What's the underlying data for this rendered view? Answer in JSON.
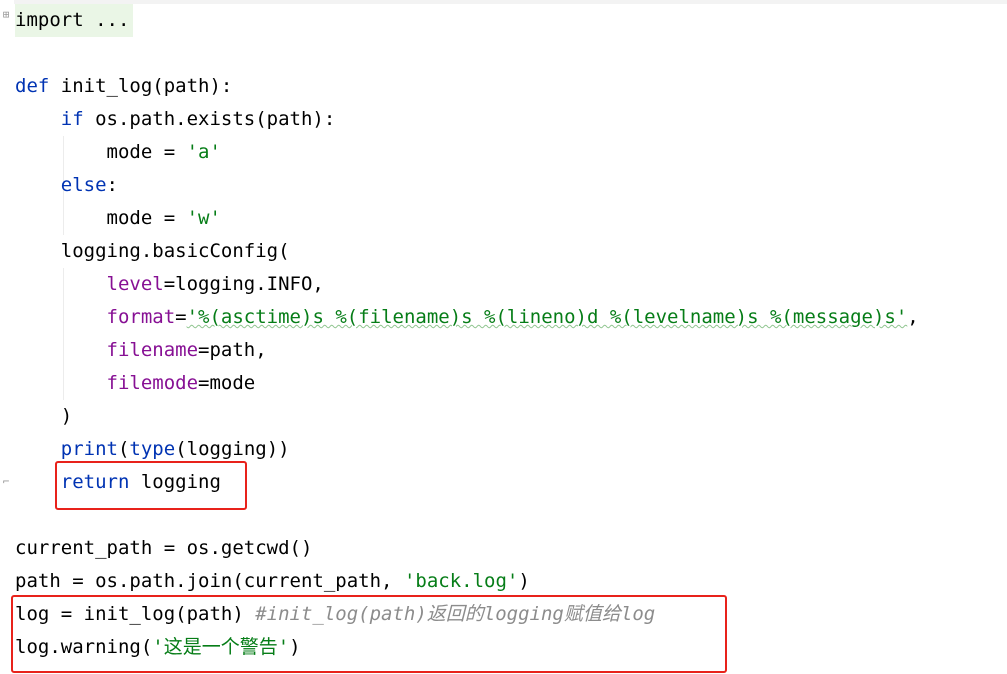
{
  "editor": {
    "lines": [
      {
        "segments": [
          {
            "t": "import ...",
            "c": "plain"
          }
        ]
      },
      {
        "segments": []
      },
      {
        "segments": [
          {
            "t": "def",
            "c": "kw"
          },
          {
            "t": " init_log(path):",
            "c": "plain"
          }
        ]
      },
      {
        "segments": [
          {
            "t": "    ",
            "c": "plain"
          },
          {
            "t": "if",
            "c": "kw"
          },
          {
            "t": " os.path.exists(path):",
            "c": "plain"
          }
        ]
      },
      {
        "segments": [
          {
            "t": "        mode = ",
            "c": "plain"
          },
          {
            "t": "'a'",
            "c": "str"
          }
        ]
      },
      {
        "segments": [
          {
            "t": "    ",
            "c": "plain"
          },
          {
            "t": "else",
            "c": "kw"
          },
          {
            "t": ":",
            "c": "plain"
          }
        ]
      },
      {
        "segments": [
          {
            "t": "        mode = ",
            "c": "plain"
          },
          {
            "t": "'w'",
            "c": "str"
          }
        ]
      },
      {
        "segments": [
          {
            "t": "    logging.basicConfig(",
            "c": "plain"
          }
        ]
      },
      {
        "segments": [
          {
            "t": "        ",
            "c": "plain"
          },
          {
            "t": "level",
            "c": "param"
          },
          {
            "t": "=logging.INFO,",
            "c": "plain"
          }
        ]
      },
      {
        "segments": [
          {
            "t": "        ",
            "c": "plain"
          },
          {
            "t": "format",
            "c": "param"
          },
          {
            "t": "=",
            "c": "plain"
          },
          {
            "t": "'%(asctime)s %(filename)s %(lineno)d %(levelname)s %(message)s'",
            "c": "str"
          },
          {
            "t": ",",
            "c": "plain"
          }
        ]
      },
      {
        "segments": [
          {
            "t": "        ",
            "c": "plain"
          },
          {
            "t": "filename",
            "c": "param"
          },
          {
            "t": "=path,",
            "c": "plain"
          }
        ]
      },
      {
        "segments": [
          {
            "t": "        ",
            "c": "plain"
          },
          {
            "t": "filemode",
            "c": "param"
          },
          {
            "t": "=mode",
            "c": "plain"
          }
        ]
      },
      {
        "segments": [
          {
            "t": "    )",
            "c": "plain"
          }
        ]
      },
      {
        "segments": [
          {
            "t": "    ",
            "c": "plain"
          },
          {
            "t": "print",
            "c": "builtin"
          },
          {
            "t": "(",
            "c": "plain"
          },
          {
            "t": "type",
            "c": "builtin"
          },
          {
            "t": "(logging))",
            "c": "plain"
          }
        ]
      },
      {
        "segments": [
          {
            "t": "    ",
            "c": "plain"
          },
          {
            "t": "return",
            "c": "kw"
          },
          {
            "t": " logging",
            "c": "plain"
          }
        ]
      },
      {
        "segments": []
      },
      {
        "segments": [
          {
            "t": "current_path = os.getcwd()",
            "c": "plain"
          }
        ]
      },
      {
        "segments": [
          {
            "t": "path = os.path.join(current_path, ",
            "c": "plain"
          },
          {
            "t": "'back.log'",
            "c": "str"
          },
          {
            "t": ")",
            "c": "plain"
          }
        ]
      },
      {
        "segments": [
          {
            "t": "log = init_log(path) ",
            "c": "plain"
          },
          {
            "t": "#init_log(path)返回的logging赋值给log",
            "c": "cmt"
          }
        ]
      },
      {
        "segments": [
          {
            "t": "log.warning(",
            "c": "plain"
          },
          {
            "t": "'这是一个警告'",
            "c": "str"
          },
          {
            "t": ")",
            "c": "plain"
          }
        ]
      }
    ]
  },
  "colors": {
    "keyword": "#0033b3",
    "string": "#067d17",
    "parameter": "#871094",
    "comment": "#8c8c8c",
    "highlight_box": "#e8221b"
  }
}
